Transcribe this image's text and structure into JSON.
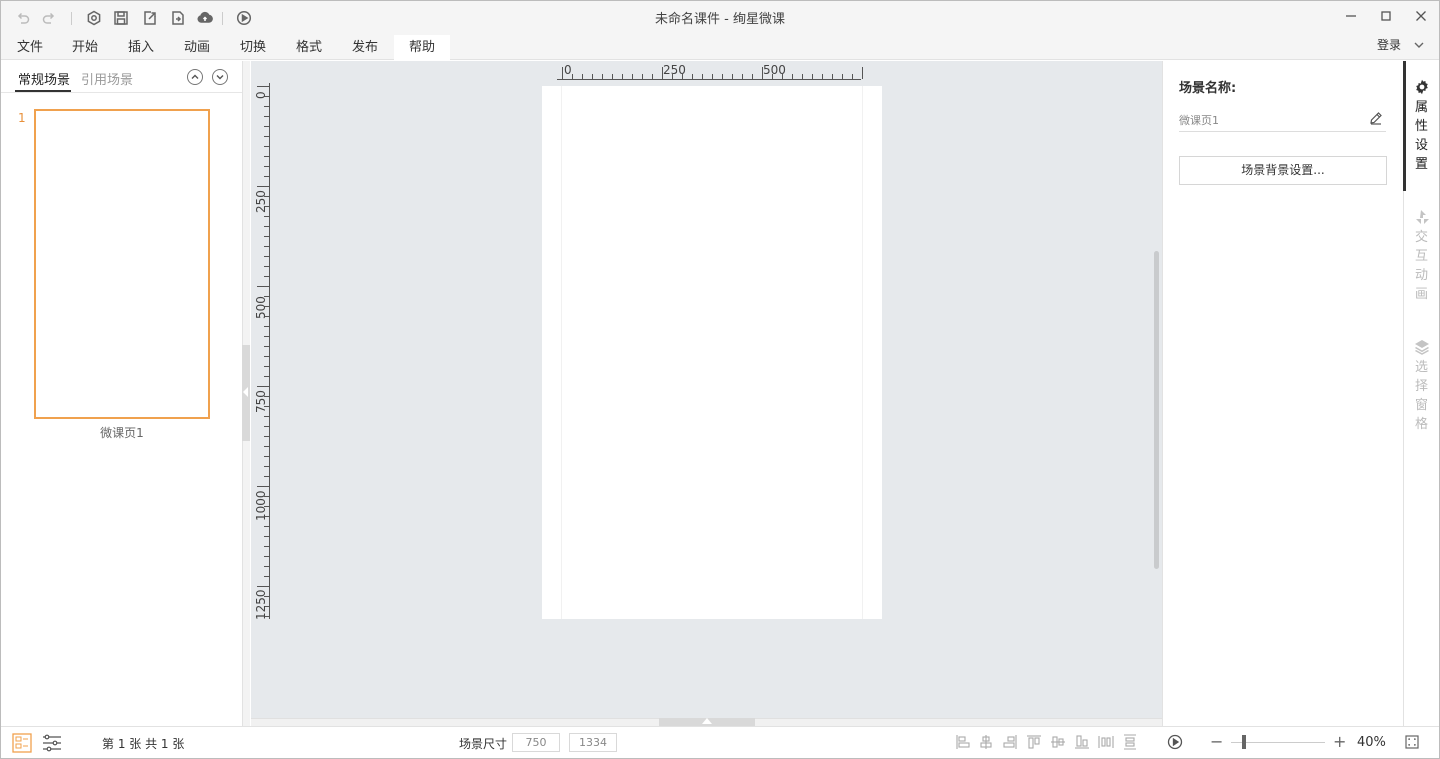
{
  "window": {
    "title": "未命名课件 - 绚星微课"
  },
  "menu": {
    "items": [
      "文件",
      "开始",
      "插入",
      "动画",
      "切换",
      "格式",
      "发布",
      "帮助"
    ],
    "active": "帮助",
    "login": "登录"
  },
  "scenes": {
    "tabs": [
      "常规场景",
      "引用场景"
    ],
    "active_tab": "常规场景",
    "items": [
      {
        "number": "1",
        "name": "微课页1"
      }
    ]
  },
  "ruler": {
    "h_labels": [
      "0",
      "250",
      "500"
    ],
    "v_labels": [
      "0",
      "250",
      "500",
      "750",
      "1000",
      "1250"
    ]
  },
  "properties": {
    "scene_name_label": "场景名称:",
    "scene_name_value": "微课页1",
    "bg_button": "场景背景设置..."
  },
  "side_tabs": [
    {
      "label": "属性设置",
      "icon": "gear-icon",
      "active": true
    },
    {
      "label": "交互动画",
      "icon": "animation-icon",
      "active": false
    },
    {
      "label": "选择窗格",
      "icon": "layers-icon",
      "active": false
    }
  ],
  "status": {
    "page_info": "第 1 张 共 1 张",
    "size_label": "场景尺寸",
    "width": "750",
    "height": "1334",
    "zoom": "40%"
  },
  "colors": {
    "accent": "#f0a14e",
    "canvas_bg": "#e6e9ec"
  }
}
